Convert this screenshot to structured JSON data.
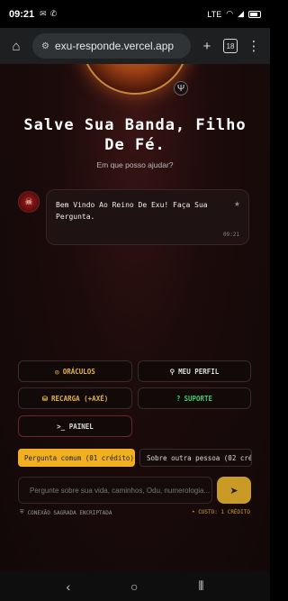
{
  "status_bar": {
    "time": "09:21",
    "network": "LTE"
  },
  "browser": {
    "url": "exu-responde.vercel.app",
    "tab_count": "18"
  },
  "hero": {
    "title": "Salve Sua Banda, Filho De Fé.",
    "subtitle": "Em que posso ajudar?"
  },
  "chat": {
    "message": "Bem Vindo Ao Reino De Exu! Faça Sua Pergunta.",
    "time": "09:21"
  },
  "menu": {
    "oraculos": "ORÁCULOS",
    "meu_perfil": "MEU PERFIL",
    "recarga": "RECARGA (+AXÉ)",
    "suporte": "SUPORTE",
    "painel": ">_ PAINEL"
  },
  "question_types": [
    {
      "label": "Pergunta comum (01 crédito)",
      "active": true
    },
    {
      "label": "Sobre outra pessoa (02 créditos)",
      "active": false
    }
  ],
  "composer": {
    "placeholder": "Pergunte sobre sua vida, caminhos, Odu, numerologia..."
  },
  "footer": {
    "left": "CONEXÃO SAGRADA ENCRIPTADA",
    "right": "• CUSTO: 1 CRÉDITO"
  },
  "colors": {
    "accent_gold": "#f0b020",
    "green": "#3ecf6e",
    "bg": "#1c0b0b"
  }
}
